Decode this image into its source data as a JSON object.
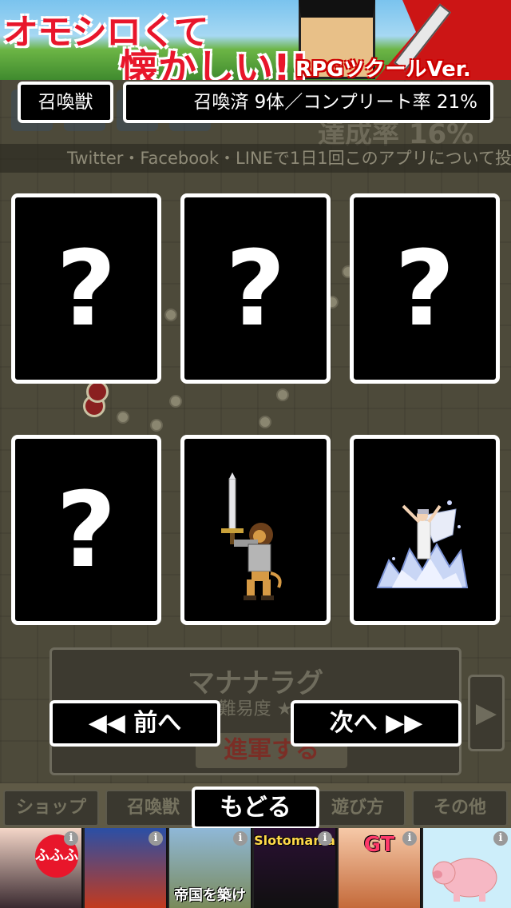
{
  "top_banner": {
    "line1": "オモシロくて",
    "line2": "懐かしい!!",
    "tag": "RPGツクールVer."
  },
  "header": {
    "title": "召喚獣",
    "stats": "召喚済 9体／コンプリート率 21%"
  },
  "background": {
    "info_text": "Twitter・Facebook・LINEで1日1回このアプリについて投",
    "rate_text": "達成率 16%",
    "stage_name": "マナナラグ",
    "stage_difficulty": "難易度 ★",
    "march_label": "進軍する",
    "arrow": "▶"
  },
  "cards": [
    {
      "state": "unknown",
      "symbol": "?"
    },
    {
      "state": "unknown",
      "symbol": "?"
    },
    {
      "state": "unknown",
      "symbol": "?"
    },
    {
      "state": "unknown",
      "symbol": "?"
    },
    {
      "state": "summoned",
      "sprite": "lion-knight-sword-sprite"
    },
    {
      "state": "summoned",
      "sprite": "ice-goddess-sprite"
    }
  ],
  "nav": {
    "prev_label": "◀◀ 前へ",
    "next_label": "次へ ▶▶"
  },
  "menu": {
    "shop": "ショップ",
    "summon": "召喚獣",
    "back": "もどる",
    "howto": "遊び方",
    "other": "その他"
  },
  "ads": {
    "info_icon": "i",
    "tile1_badge": "ふふふ",
    "tile3_label": "帝国を築け",
    "tile4_label": "Slotomania",
    "tile5_label": "GT"
  }
}
